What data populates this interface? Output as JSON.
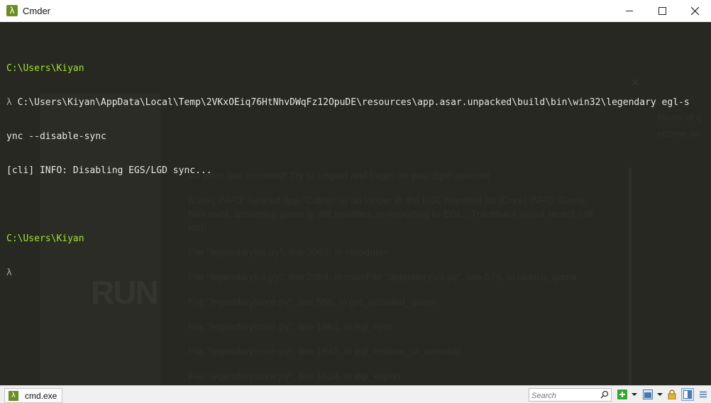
{
  "window": {
    "title": "Cmder",
    "app_icon_glyph": "λ"
  },
  "terminal": {
    "line1_path": "C:\\Users\\Kiyan",
    "line2_prompt": "λ",
    "line2_cmd": "C:\\Users\\Kiyan\\AppData\\Local\\Temp\\2VKxOEiq76HtNhvDWqFz12OpuDE\\resources\\app.asar.unpacked\\build\\bin\\win32\\legendary egl-s",
    "line3": "ync --disable-sync",
    "line4": "[cli] INFO: Disabling EGS/LGD sync...",
    "line6_path": "C:\\Users\\Kiyan",
    "line7_prompt": "λ"
  },
  "background_app": {
    "art_text": "RUN",
    "right_text_1": "Illions of g",
    "right_text_2": "ecome wi",
    "error_lines": [
      "An error has occurred! Try to Logout and Login on your Epic account",
      "[Core] INFO: Synced app \"Catnip\" is no longer in the EGL manifest list.[Core] INFO: Game",
      "files exist, assuming game is still installed, re-exporting to EGL...Traceback (most recent call",
      "last):",
      "File \"legendary\\cli.py\", line 3069, in <module>",
      "File \"legendary\\cli.py\", line 2984, in mainFile \"legendary\\cli.py\", line 578, in launch_game",
      "File \"legendary\\core.py\", line 566, in get_installed_game",
      "File \"legendary\\core.py\", line 1861, in egl_sync",
      "File \"legendary\\core.py\", line 1847, in egl_restore_or_uninstall",
      "File \"legendary\\core.py\", line 1824, in egl_export"
    ]
  },
  "statusbar": {
    "tab_label": "cmd.exe",
    "tab_icon_glyph": "λ",
    "search_placeholder": "Search"
  },
  "colors": {
    "terminal_bg": "#272822",
    "prompt_path": "#a6e22e",
    "text": "#e8e8e3",
    "icon_green": "#6b8e23",
    "add_tab_green": "#2fa82f"
  },
  "icons": [
    "lambda-icon",
    "minimize-icon",
    "maximize-icon",
    "close-icon",
    "search-icon",
    "add-tab-icon",
    "dropdown-icon",
    "console-icon",
    "lock-icon",
    "layout-icon",
    "menu-icon"
  ]
}
